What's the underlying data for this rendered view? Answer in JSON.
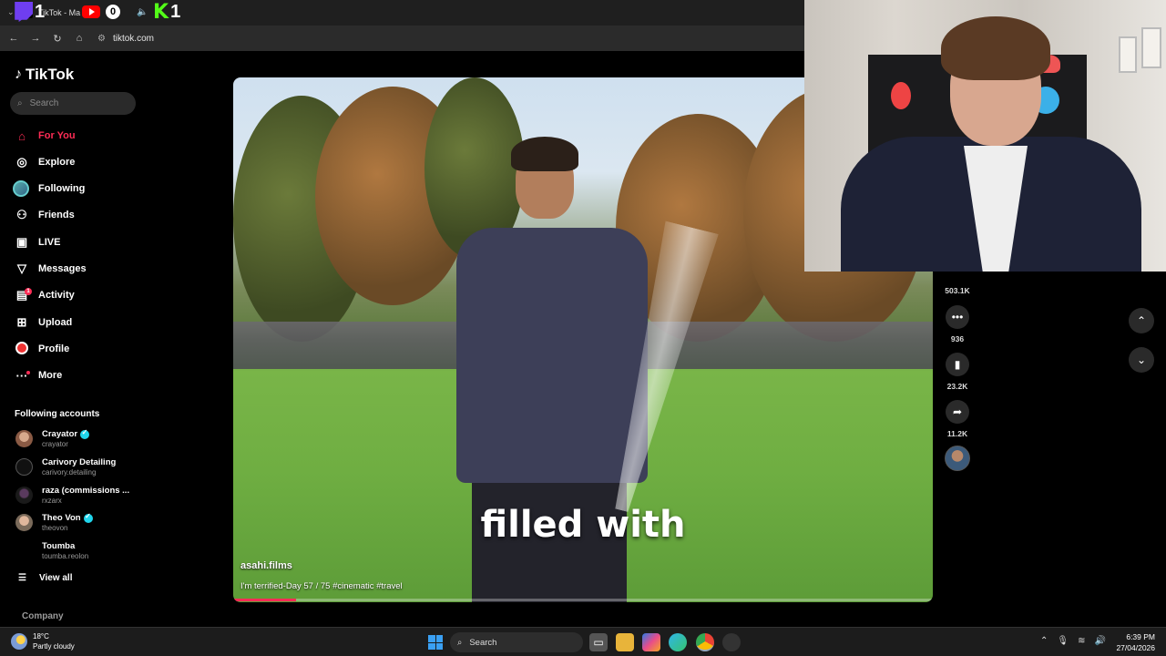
{
  "browser": {
    "tab_title": "TikTok - Ma",
    "url": "tiktok.com"
  },
  "stream_overlay": {
    "twitch_count": "1",
    "youtube_count": "0",
    "kick_count": "1"
  },
  "sidebar": {
    "logo": "TikTok",
    "search_placeholder": "Search",
    "nav": [
      {
        "label": "For You",
        "icon": "home-icon"
      },
      {
        "label": "Explore",
        "icon": "compass-icon"
      },
      {
        "label": "Following",
        "icon": "avatar-icon"
      },
      {
        "label": "Friends",
        "icon": "friends-icon"
      },
      {
        "label": "LIVE",
        "icon": "live-icon"
      },
      {
        "label": "Messages",
        "icon": "messages-icon"
      },
      {
        "label": "Activity",
        "icon": "activity-icon",
        "badge": "1"
      },
      {
        "label": "Upload",
        "icon": "upload-icon"
      },
      {
        "label": "Profile",
        "icon": "profile-icon"
      },
      {
        "label": "More",
        "icon": "more-icon"
      }
    ],
    "following_heading": "Following accounts",
    "accounts": [
      {
        "name": "Crayator",
        "handle": "crayator",
        "verified": true
      },
      {
        "name": "Carivory Detailing",
        "handle": "carivory.detailing",
        "verified": false
      },
      {
        "name": "raza (commissions ...",
        "handle": "rxzarx",
        "verified": false
      },
      {
        "name": "Theo Von",
        "handle": "theovon",
        "verified": true
      },
      {
        "name": "Toumba",
        "handle": "toumba.reolon",
        "verified": false
      }
    ],
    "view_all": "View all",
    "company": "Company"
  },
  "video": {
    "caption_overlay": "filled with",
    "author": "asahi.films",
    "description": "I'm terrified-Day 57 / 75 #cinematic #travel",
    "progress": 0.09
  },
  "actions": {
    "likes": "503.1K",
    "comments": "936",
    "saves": "23.2K",
    "shares": "11.2K"
  },
  "taskbar": {
    "temperature": "18°C",
    "weather": "Partly cloudy",
    "search": "Search",
    "time": "6:39 PM",
    "date": "27/04/2026"
  },
  "colors": {
    "accent": "#fe2c55",
    "verified": "#20d5ec"
  }
}
